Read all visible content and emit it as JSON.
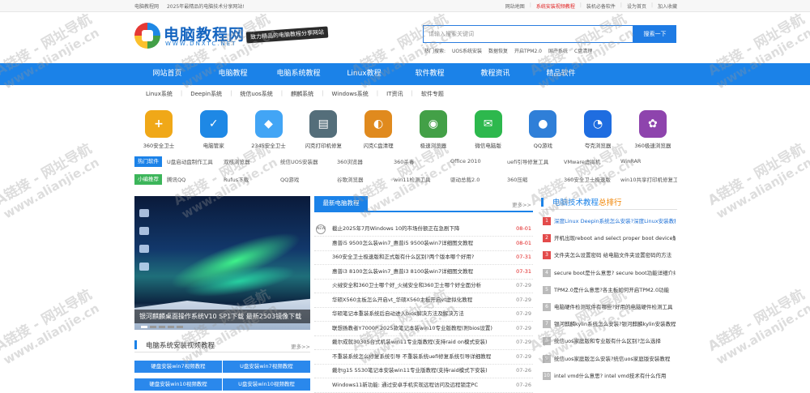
{
  "topbar": {
    "left": [
      "电脑教程网",
      "2025年最精品的电脑技术分享网站!"
    ],
    "right": [
      "网站地图",
      "系统安装视频教程",
      "装机必备软件",
      "设为首页",
      "加入收藏"
    ]
  },
  "header": {
    "logo_text": "电脑教程网",
    "logo_url": "WWW.DNXTC.NET",
    "slogan": "致力精品的电脑教程分享网站",
    "search_placeholder": "请输入搜索关键词",
    "search_button": "搜索一下",
    "hotwords": [
      "热门搜索:",
      "UOS系统安装",
      "数据恢复",
      "开启TPM2.0",
      "国产系统",
      "C盘清理"
    ]
  },
  "nav": [
    "网站首页",
    "电脑教程",
    "电脑系统教程",
    "Linux教程",
    "软件教程",
    "教程资讯",
    "精品软件"
  ],
  "subnav": [
    "Linux系统",
    "Deepin系统",
    "统信uos系统",
    "麒麟系统",
    "Windows系统",
    "IT资讯",
    "软件专题"
  ],
  "apps": [
    {
      "name": "360安全卫士",
      "color": "#f0a818",
      "glyph": "+"
    },
    {
      "name": "电脑管家",
      "color": "#1e88e5",
      "glyph": "✓"
    },
    {
      "name": "2345安全卫士",
      "color": "#42a5f5",
      "glyph": "◆"
    },
    {
      "name": "闪克打印机修复",
      "color": "#546e7a",
      "glyph": "▤"
    },
    {
      "name": "闪克C盘清理",
      "color": "#e08a1e",
      "glyph": "◐"
    },
    {
      "name": "极速浏览器",
      "color": "#43a047",
      "glyph": "◉"
    },
    {
      "name": "微信电脑版",
      "color": "#2db84d",
      "glyph": "✉"
    },
    {
      "name": "QQ游戏",
      "color": "#2f7fd8",
      "glyph": "●"
    },
    {
      "name": "夸克浏览器",
      "color": "#1f6de0",
      "glyph": "◔"
    },
    {
      "name": "360极速浏览器",
      "color": "#8e44ad",
      "glyph": "✿"
    }
  ],
  "hot_software": {
    "tag": "热门软件",
    "items": [
      "U盘启动盘制作工具",
      "双核浏览器",
      "统信UOS安装器",
      "360浏览器",
      "360杀毒",
      "Office 2010",
      "uefi引导修复工具",
      "VMware虚拟机",
      "WinRAR"
    ]
  },
  "small_picks": {
    "tag": "小编推荐",
    "items": [
      "腾讯QQ",
      "Rufus下载",
      "QQ游戏",
      "谷歌浏览器",
      "win11检测工具",
      "驱动总裁2.0",
      "360压缩",
      "360安全卫士极速版",
      "win10共享打印机修复工具"
    ]
  },
  "banner": {
    "caption": "银河麒麟桌面操作系统V10 SP1下载 最新2503镜像下载"
  },
  "video": {
    "title": "电脑系统安装视频教程",
    "more": "更多>>",
    "buttons": [
      "硬盘安装win7视频教程",
      "U盘安装win7视频教程",
      "硬盘安装win10视频教程",
      "U盘安装win10视频教程"
    ]
  },
  "news": {
    "title": "最新电脑教程",
    "more": "更多>>",
    "items": [
      {
        "title": "截止2025年7月Windows 10的市场份额正在急剧下降",
        "date": "08-01",
        "new": true
      },
      {
        "title": "惠普i5 9500怎么装win7_惠普i5 9500装win7详细图文教程",
        "date": "08-01"
      },
      {
        "title": "360安全卫士极速版和正式版有什么区别?两个版本哪个好用?",
        "date": "07-31"
      },
      {
        "title": "惠普i3 8100怎么装win7_惠普i3 8100装win7详细图文教程",
        "date": "07-31"
      },
      {
        "title": "火绒安全和360卫士哪个好_火绒安全和360卫士哪个好全面分析",
        "date": "07-29"
      },
      {
        "title": "华硕X560主板怎么开启vt_华硕X560主板开启vt虚拟化教程",
        "date": "07-29"
      },
      {
        "title": "华硕笔记本重装系统后自动进入bios解决方法及解决方法",
        "date": "07-29"
      },
      {
        "title": "联想扬教者Y7000P 2025款笔记本装win10专业版教程(附bios设置)",
        "date": "07-29"
      },
      {
        "title": "戴尔成就3030S台式机装win11专业版教程(支持raid on模式安装)",
        "date": "07-29"
      },
      {
        "title": "不重装系统怎么修复系统引导 不重装系统uefi修复系统引导详细教程",
        "date": "07-29"
      },
      {
        "title": "戴尔g15 5530笔记本安装win11专业版教程(支持raid模式下安装)",
        "date": "07-26"
      },
      {
        "title": "Windows11新功能: 通过安卓手机实现远程访问及远程锁定PC",
        "date": "07-26"
      }
    ]
  },
  "ranking": {
    "title_a": "电脑技术教程",
    "title_b": "总排行",
    "items": [
      "深度Linux Deepin系统怎么安装?深度Linux安装教程",
      "开机出现reboot and select proper boot device解决方法",
      "文件夹怎么设置密码 给电脑文件夹设置密码的方法",
      "secure boot是什么意思? secure boot功能详细介绍",
      "TPM2.0是什么意思?各主板如何开启TPM2.0功能",
      "电脑硬件检测软件有哪些?好用的电脑硬件检测工具",
      "银河麒麟kylin系统怎么安装?银河麒麟kylin安装教程",
      "统信uos家庭版和专业版有什么区别?怎么选择",
      "统信uos家庭版怎么安装?统信uos家庭版安装教程",
      "intel vmd什么意思? intel vmd技术有什么作用"
    ]
  },
  "watermark": {
    "line1": "A链接 - 网址导航",
    "line2": "www.alianjie.cn"
  },
  "colors": {
    "brand_blue": "#1b82e8",
    "accent_orange": "#f08300",
    "hot_tag": "#1b82e8",
    "pick_tag": "#3cb55a",
    "date_red": "#e02020"
  }
}
